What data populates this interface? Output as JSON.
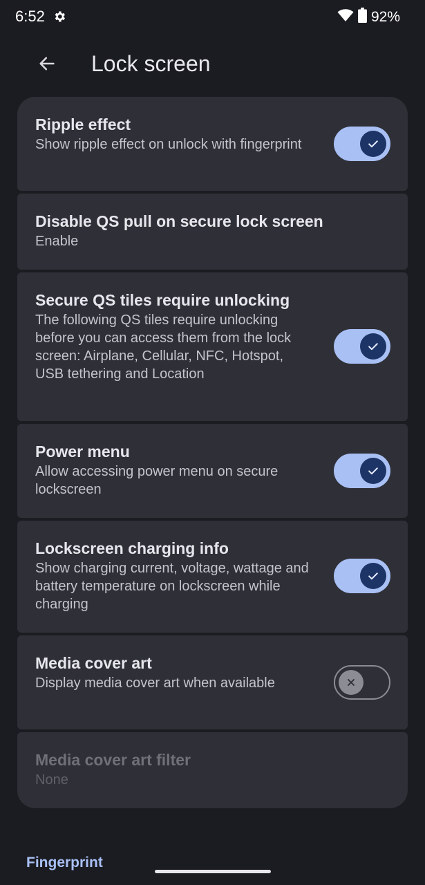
{
  "status_bar": {
    "time": "6:52",
    "battery_percent": "92%",
    "icons": [
      "gear-icon",
      "wifi-icon",
      "battery-icon"
    ]
  },
  "app_bar": {
    "title": "Lock screen",
    "back_icon": "back-arrow-icon"
  },
  "preferences": [
    {
      "title": "Ripple effect",
      "summary": "Show ripple effect on unlock with fingerprint",
      "toggle": true
    },
    {
      "title": "Disable QS pull on secure lock screen",
      "summary": "Enable",
      "toggle": null
    },
    {
      "title": "Secure QS tiles require unlocking",
      "summary": "The following QS tiles require unlocking before you can access them from the lock screen: Airplane, Cellular, NFC, Hotspot, USB tethering and Location",
      "toggle": true
    },
    {
      "title": "Power menu",
      "summary": "Allow accessing power menu on secure lockscreen",
      "toggle": true
    },
    {
      "title": "Lockscreen charging info",
      "summary": "Show charging current, voltage, wattage and battery temperature on lockscreen while charging",
      "toggle": true
    },
    {
      "title": "Media cover art",
      "summary": "Display media cover art when available",
      "toggle": false
    },
    {
      "title": "Media cover art filter",
      "summary": "None",
      "toggle": null,
      "disabled": true
    }
  ],
  "footer": {
    "section_label": "Fingerprint"
  },
  "colors": {
    "background": "#1b1c21",
    "card": "#2f3037",
    "accent": "#a9c0f5",
    "toggle_thumb_on": "#1d3466"
  }
}
